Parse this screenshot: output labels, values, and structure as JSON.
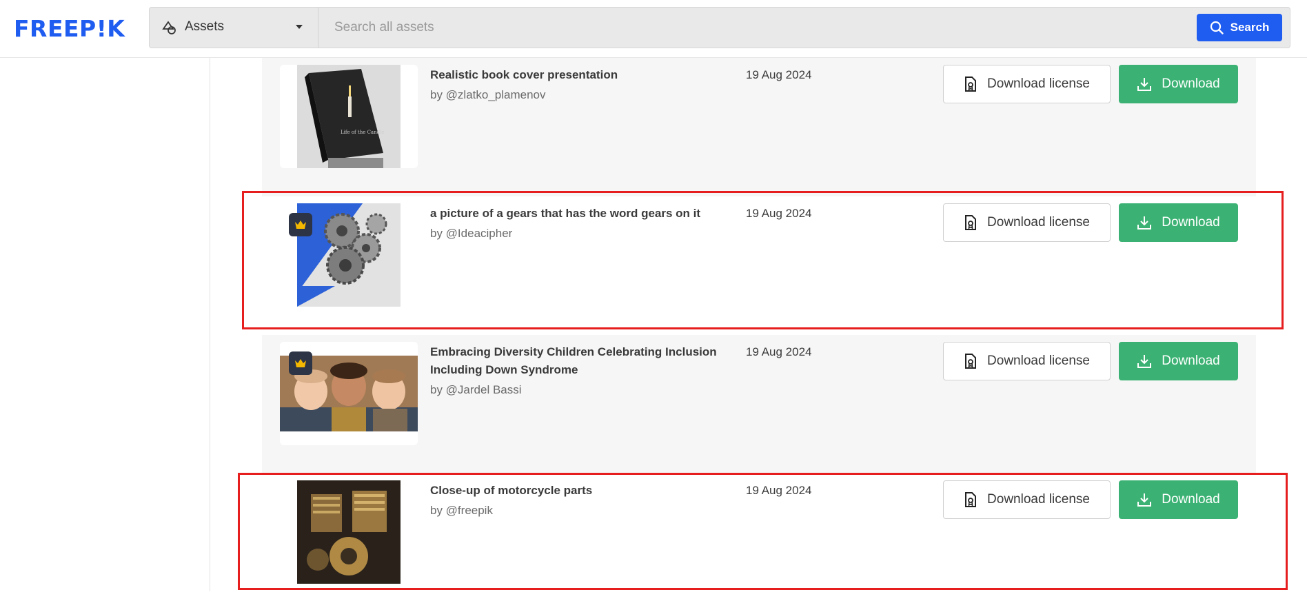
{
  "brand": {
    "logo_text": "FREEP!K",
    "accent": "#1f5cf0"
  },
  "search": {
    "category_label": "Assets",
    "category_icon": "assets-shapes-icon",
    "placeholder": "Search all assets",
    "value": "",
    "button_label": "Search"
  },
  "colors": {
    "download_green": "#3bb273",
    "highlight_red": "#e61e1e",
    "premium_badge": "#2d3445",
    "crown_gold": "#f5b800"
  },
  "rows": [
    {
      "title": "Realistic book cover presentation",
      "author": "by @zlatko_plamenov",
      "date": "19 Aug 2024",
      "premium": false,
      "license_label": "Download license",
      "download_label": "Download"
    },
    {
      "title": "a picture of a gears that has the word gears on it",
      "author": "by @Ideacipher",
      "date": "19 Aug 2024",
      "premium": true,
      "license_label": "Download license",
      "download_label": "Download"
    },
    {
      "title": "Embracing Diversity Children Celebrating Inclusion Including Down Syndrome",
      "author": "by @Jardel Bassi",
      "date": "19 Aug 2024",
      "premium": true,
      "license_label": "Download license",
      "download_label": "Download"
    },
    {
      "title": "Close-up of motorcycle parts",
      "author": "by @freepik",
      "date": "19 Aug 2024",
      "premium": false,
      "license_label": "Download license",
      "download_label": "Download"
    }
  ]
}
